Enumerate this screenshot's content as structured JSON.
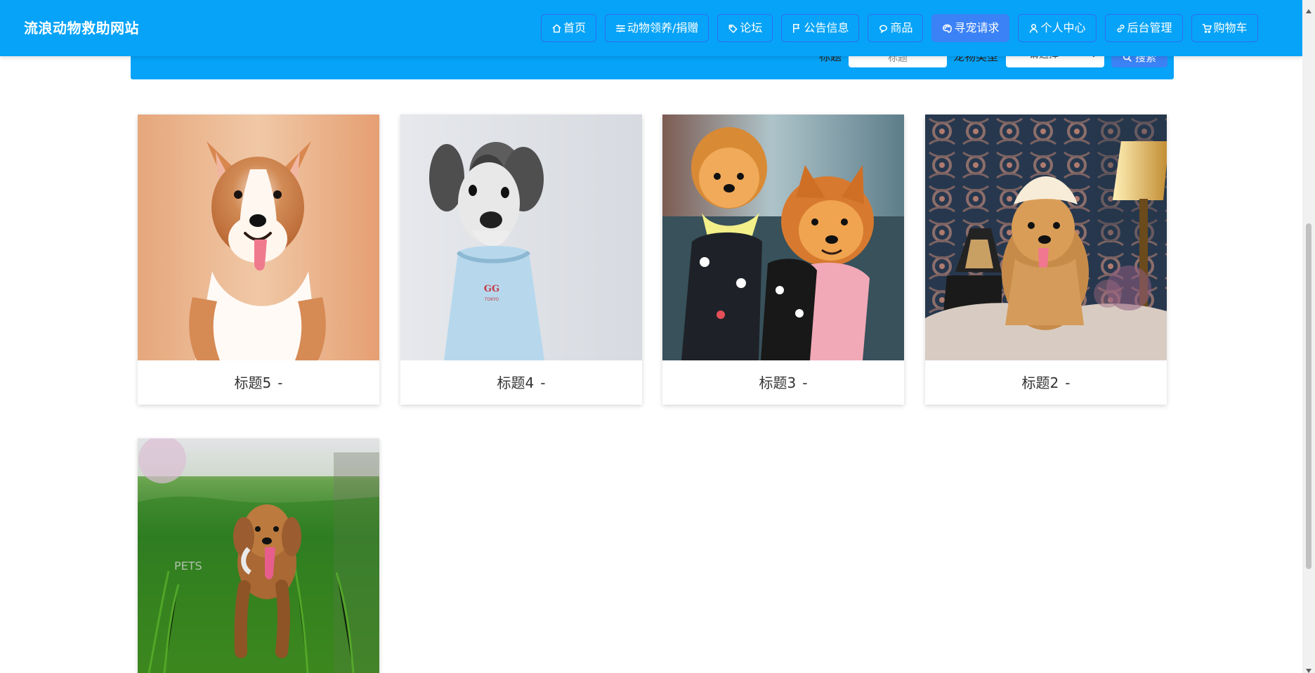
{
  "header": {
    "site_title": "流浪动物救助网站",
    "active_nav": "寻宠请求",
    "nav": [
      {
        "label": "首页",
        "icon": "home-icon"
      },
      {
        "label": "动物领养/捐赠",
        "icon": "sliders-icon"
      },
      {
        "label": "论坛",
        "icon": "tag-icon"
      },
      {
        "label": "公告信息",
        "icon": "flag-icon"
      },
      {
        "label": "商品",
        "icon": "bubble-icon"
      },
      {
        "label": "寻宠请求",
        "icon": "palette-icon"
      },
      {
        "label": "个人中心",
        "icon": "user-icon"
      },
      {
        "label": "后台管理",
        "icon": "link-icon"
      },
      {
        "label": "购物车",
        "icon": "cart-icon"
      }
    ]
  },
  "search": {
    "title_label": "标题",
    "title_placeholder": "标题",
    "pet_type_label": "宠物类型",
    "pet_type_selected": "请选择",
    "search_button": "搜索",
    "icon": "search-icon"
  },
  "cards": [
    {
      "title": "标题5",
      "dash": "-"
    },
    {
      "title": "标题4",
      "dash": "-"
    },
    {
      "title": "标题3",
      "dash": "-"
    },
    {
      "title": "标题2",
      "dash": "-"
    },
    {
      "title": "",
      "dash": ""
    }
  ],
  "colors": {
    "header": "#06a3f8",
    "active_button": "#3b82f6",
    "button_border": "#2f6df0",
    "text": "#333333"
  }
}
